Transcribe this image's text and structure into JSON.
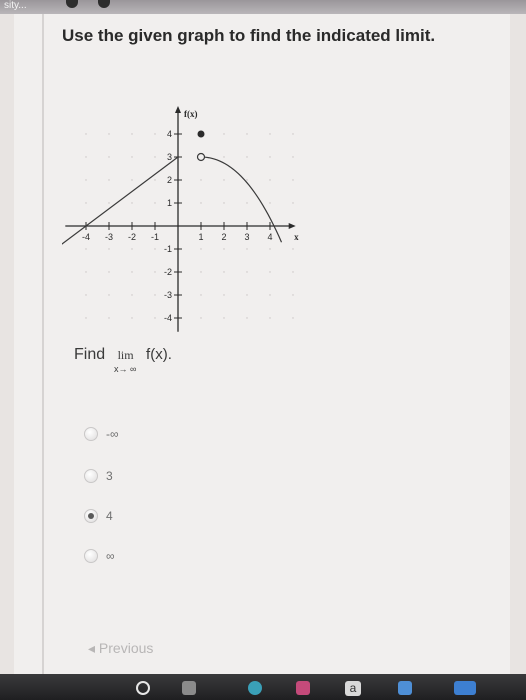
{
  "top_bar": {
    "crumb": "sity..."
  },
  "question": {
    "title": "Use the given graph to find the indicated limit."
  },
  "graph": {
    "y_axis_label": "f(x)",
    "x_axis_label": "x",
    "x_ticks": [
      "-4",
      "-3",
      "-2",
      "-1",
      "1",
      "2",
      "3",
      "4"
    ],
    "y_ticks": [
      "4",
      "3",
      "2",
      "1",
      "-1",
      "-2",
      "-3",
      "-4"
    ],
    "line_points": [
      [
        -4,
        0
      ],
      [
        0,
        3
      ]
    ],
    "open_point": [
      1,
      3
    ],
    "closed_point": [
      1,
      4
    ],
    "curve_points": [
      [
        1,
        3
      ],
      [
        2,
        2.75
      ],
      [
        3,
        2
      ],
      [
        4,
        0.6
      ],
      [
        4.5,
        -0.3
      ]
    ]
  },
  "prompt": {
    "find": "Find",
    "lim": "lim",
    "fx": "f(x).",
    "limit_sub": "x→ ∞"
  },
  "choices": [
    {
      "label": "-∞",
      "selected": false
    },
    {
      "label": "3",
      "selected": false
    },
    {
      "label": "4",
      "selected": true
    },
    {
      "label": "∞",
      "selected": false
    }
  ],
  "nav": {
    "previous": "◂ Previous"
  },
  "taskbar": {
    "app_label": "a"
  }
}
